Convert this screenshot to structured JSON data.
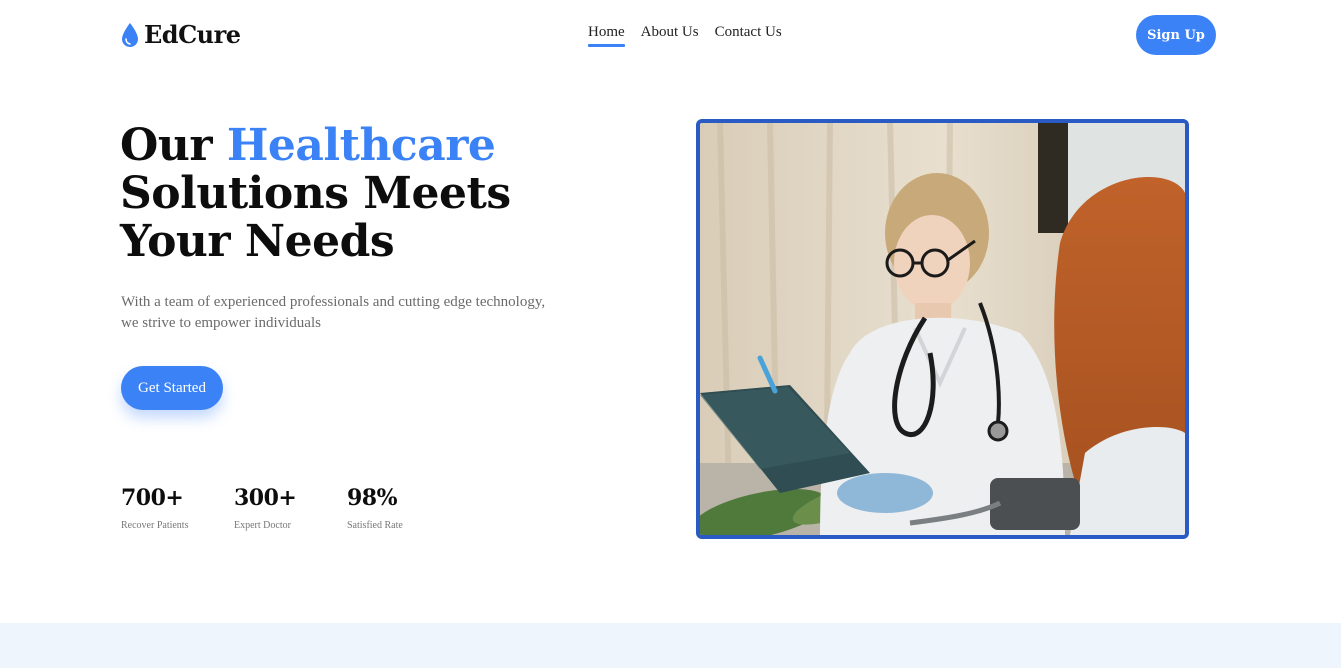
{
  "brand": {
    "name": "EdCure",
    "icon": "water-drop-icon",
    "accent_color": "#3b82f6"
  },
  "nav": {
    "items": [
      {
        "label": "Home",
        "active": true
      },
      {
        "label": "About Us",
        "active": false
      },
      {
        "label": "Contact Us",
        "active": false
      }
    ],
    "signup_label": "Sign Up"
  },
  "hero": {
    "title_part1": "Our ",
    "title_accent": "Healthcare",
    "title_line2": "Solutions Meets",
    "title_line3": "Your Needs",
    "description_line1": "With a team of experienced professionals and cutting edge technology,",
    "description_line2": "we strive to empower individuals",
    "cta_label": "Get Started"
  },
  "stats": [
    {
      "value": "700+",
      "label": "Recover Patients"
    },
    {
      "value": "300+",
      "label": "Expert Doctor"
    },
    {
      "value": "98%",
      "label": "Satisfied Rate"
    }
  ],
  "hero_image": {
    "subject": "doctor-with-stethoscope-and-patient-photo",
    "frame_color": "#2a5bc4"
  },
  "footer_band_color": "#eff5fd"
}
